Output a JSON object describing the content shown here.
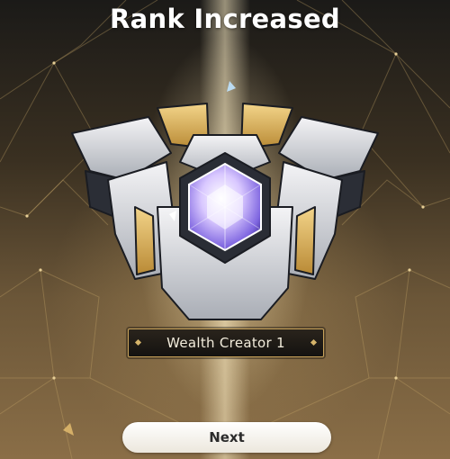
{
  "screen": {
    "title": "Rank Increased",
    "rank_name": "Wealth Creator 1",
    "next_label": "Next"
  },
  "icons": {
    "emblem": "rank-emblem-icon",
    "gem": "crystal-gem-icon"
  },
  "colors": {
    "accent_gold": "#c9a35a",
    "button_bg": "#f4f1ea",
    "title_text": "#ffffff"
  }
}
